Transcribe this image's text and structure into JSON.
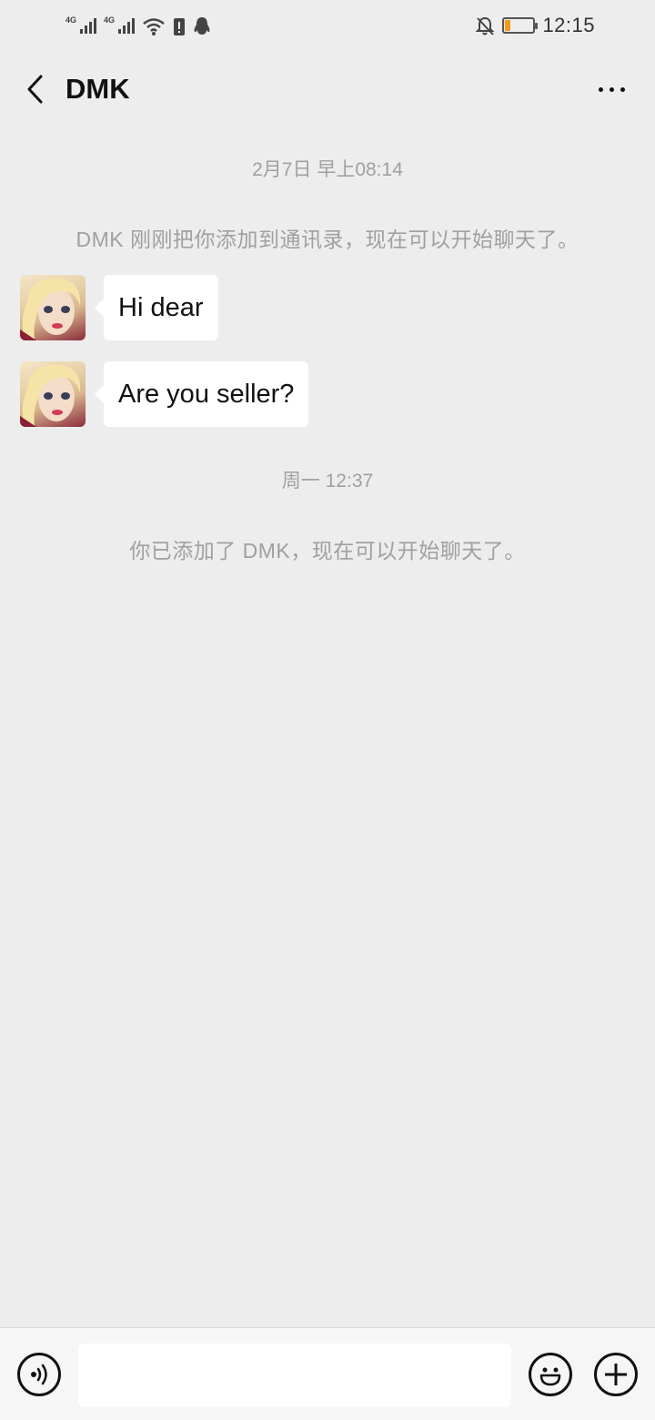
{
  "status_bar": {
    "left_icons": [
      "signal-4g-icon",
      "signal-4g-icon",
      "wifi-icon",
      "alert-icon",
      "qq-icon"
    ],
    "network_label_1": "4G",
    "network_label_2": "4G",
    "right_icons": [
      "mute-bell-icon",
      "battery-icon"
    ],
    "battery_level_fraction": 0.18,
    "battery_color": "#f39a1d",
    "time": "12:15"
  },
  "header": {
    "title": "DMK",
    "back_icon": "chevron-left-icon",
    "more_icon": "more-dots-icon"
  },
  "chat": {
    "timestamp_1": "2月7日 早上08:14",
    "system_1": "DMK 刚刚把你添加到通讯录，现在可以开始聊天了。",
    "messages": [
      {
        "sender": "DMK",
        "text": "Hi dear"
      },
      {
        "sender": "DMK",
        "text": "Are you seller?"
      }
    ],
    "timestamp_2": "周一 12:37",
    "system_2": "你已添加了 DMK，现在可以开始聊天了。"
  },
  "input_bar": {
    "voice_icon": "voice-icon",
    "input_value": "",
    "emoji_icon": "emoji-icon",
    "plus_icon": "plus-icon"
  },
  "colors": {
    "background": "#ededed",
    "bubble": "#ffffff",
    "system_text": "#a0a0a0",
    "input_bar": "#f6f6f6"
  }
}
